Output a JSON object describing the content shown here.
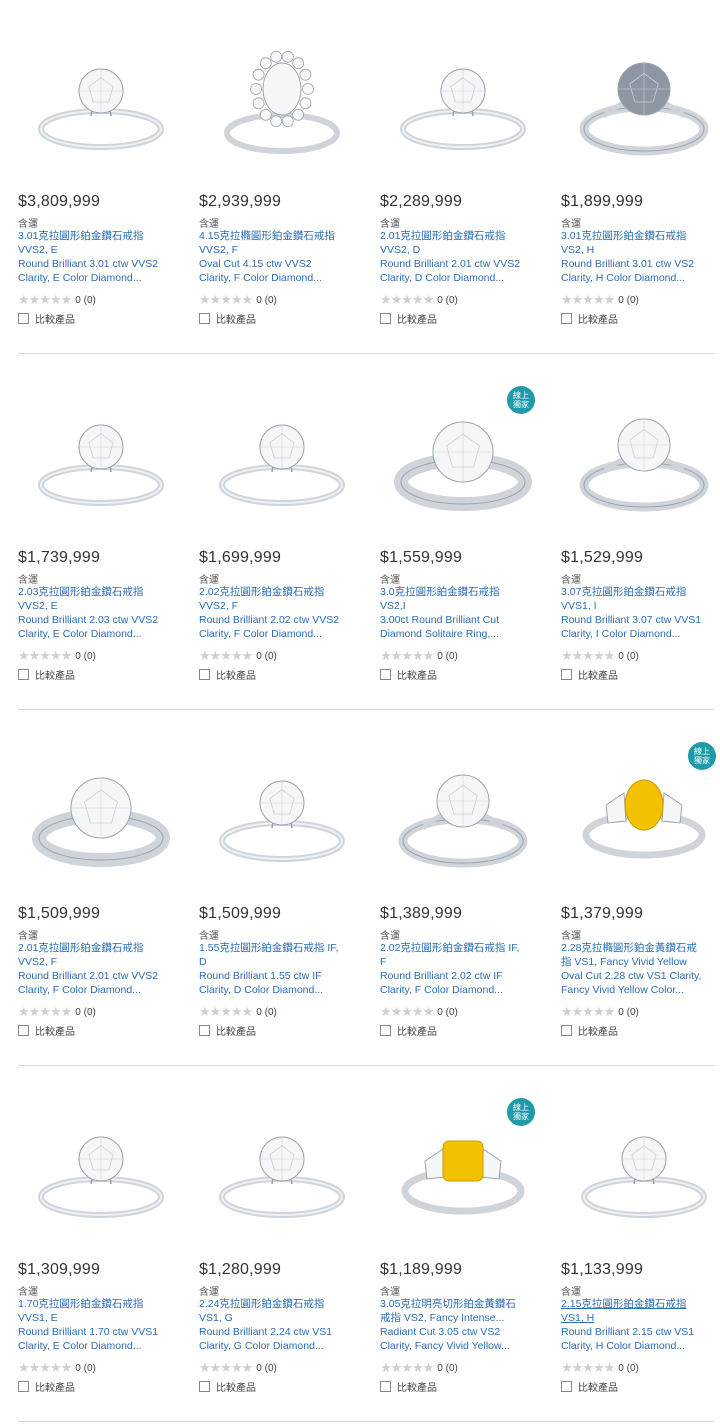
{
  "tax_label": "含運",
  "compare_label": "比較產品",
  "badge_label": [
    "線上",
    "獨家"
  ],
  "products": [
    {
      "price": "$3,809,999",
      "title": [
        "3.01克拉圓形鉑金鑽石戒指",
        "VVS2, E",
        "Round Brilliant 3.01 ctw VVS2",
        "Clarity, E Color Diamond..."
      ],
      "rating": "0 (0)",
      "badge": false,
      "ring": "solitaire-thin",
      "diamond": "white"
    },
    {
      "price": "$2,939,999",
      "title": [
        "4.15克拉橢圓形鉑金鑽石戒指",
        "VVS2, F",
        "Oval Cut 4.15 ctw VVS2",
        "Clarity, F Color Diamond..."
      ],
      "rating": "0 (0)",
      "badge": false,
      "ring": "halo-oval",
      "diamond": "white"
    },
    {
      "price": "$2,289,999",
      "title": [
        "2.01克拉圓形鉑金鑽石戒指",
        "VVS2, D",
        "Round Brilliant 2.01 ctw VVS2",
        "Clarity, D Color Diamond..."
      ],
      "rating": "0 (0)",
      "badge": false,
      "ring": "solitaire-thin",
      "diamond": "white"
    },
    {
      "price": "$1,899,999",
      "title": [
        "3.01克拉圓形鉑金鑽石戒指",
        "VS2, H",
        "Round Brilliant 3.01 ctw VS2",
        "Clarity, H Color Diamond..."
      ],
      "rating": "0 (0)",
      "badge": false,
      "ring": "cathedral",
      "diamond": "grey"
    },
    {
      "price": "$1,739,999",
      "title": [
        "2.03克拉圓形鉑金鑽石戒指",
        "VVS2, E",
        "Round Brilliant 2.03 ctw VVS2",
        "Clarity, E Color Diamond..."
      ],
      "rating": "0 (0)",
      "badge": false,
      "ring": "solitaire-thin",
      "diamond": "white"
    },
    {
      "price": "$1,699,999",
      "title": [
        "2.02克拉圓形鉑金鑽石戒指",
        "VVS2, F",
        "Round Brilliant 2.02 ctw VVS2",
        "Clarity, F Color Diamond..."
      ],
      "rating": "0 (0)",
      "badge": false,
      "ring": "solitaire-thin",
      "diamond": "white"
    },
    {
      "price": "$1,559,999",
      "title": [
        "3.0克拉圓形鉑金鑽石戒指",
        "VS2,I",
        "3.00ct Round Brilliant Cut",
        "Diamond Solitaire Ring,..."
      ],
      "rating": "0 (0)",
      "badge": true,
      "ring": "wide",
      "diamond": "white"
    },
    {
      "price": "$1,529,999",
      "title": [
        "3.07克拉圓形鉑金鑽石戒指",
        "VVS1, I",
        "Round Brilliant 3.07 ctw VVS1",
        "Clarity, I Color Diamond..."
      ],
      "rating": "0 (0)",
      "badge": false,
      "ring": "cathedral",
      "diamond": "white"
    },
    {
      "price": "$1,509,999",
      "title": [
        "2.01克拉圓形鉑金鑽石戒指",
        "VVS2, F",
        "Round Brilliant 2.01 ctw VVS2",
        "Clarity, F Color Diamond..."
      ],
      "rating": "0 (0)",
      "badge": false,
      "ring": "wide",
      "diamond": "white"
    },
    {
      "price": "$1,509,999",
      "title": [
        "1.55克拉圓形鉑金鑽石戒指 IF,",
        "D",
        "Round Brilliant 1.55 ctw IF",
        "Clarity, D Color Diamond..."
      ],
      "rating": "0 (0)",
      "badge": false,
      "ring": "solitaire-thin",
      "diamond": "white"
    },
    {
      "price": "$1,389,999",
      "title": [
        "2.02克拉圓形鉑金鑽石戒指 IF,",
        "F",
        "Round Brilliant 2.02 ctw IF",
        "Clarity, F Color Diamond..."
      ],
      "rating": "0 (0)",
      "badge": false,
      "ring": "cathedral",
      "diamond": "white"
    },
    {
      "price": "$1,379,999",
      "title": [
        "2.28克拉橢圓形鉑金黃鑽石戒",
        "指 VS1, Fancy Vivid Yellow",
        "Oval Cut 2.28 ctw VS1 Clarity,",
        "Fancy Vivid Yellow Color..."
      ],
      "rating": "0 (0)",
      "badge": true,
      "ring": "three-stone",
      "diamond": "yellow"
    },
    {
      "price": "$1,309,999",
      "title": [
        "1.70克拉圓形鉑金鑽石戒指",
        "VVS1, E",
        "Round Brilliant 1.70 ctw VVS1",
        "Clarity, E Color Diamond..."
      ],
      "rating": "0 (0)",
      "badge": false,
      "ring": "solitaire-thin",
      "diamond": "white"
    },
    {
      "price": "$1,280,999",
      "title": [
        "2.24克拉圓形鉑金鑽石戒指",
        "VS1, G",
        "Round Brilliant 2.24 ctw VS1",
        "Clarity, G Color Diamond..."
      ],
      "rating": "0 (0)",
      "badge": false,
      "ring": "solitaire-thin",
      "diamond": "white"
    },
    {
      "price": "$1,189,999",
      "title": [
        "3.05克拉明亮切形鉑金黃鑽石",
        "戒指 VS2, Fancy Intense...",
        "Radiant Cut 3.05 ctw VS2",
        "Clarity, Fancy Vivid Yellow..."
      ],
      "rating": "0 (0)",
      "badge": true,
      "ring": "three-stone-radiant",
      "diamond": "yellow"
    },
    {
      "price": "$1,133,999",
      "title": [
        "2.15克拉圓形鉑金鑽石戒指",
        "VS1, H",
        "Round Brilliant 2.15 ctw VS1",
        "Clarity, H Color Diamond..."
      ],
      "rating": "0 (0)",
      "badge": false,
      "ring": "solitaire-thin",
      "diamond": "white",
      "underline": true
    }
  ]
}
